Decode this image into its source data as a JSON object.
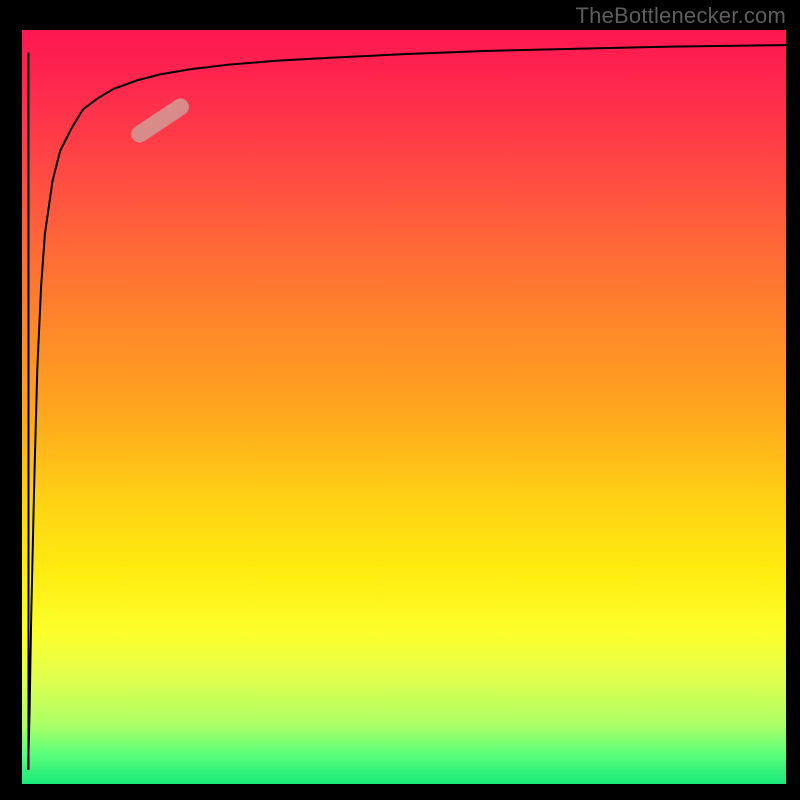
{
  "watermark": "TheBottlenecker.com",
  "chart_data": {
    "type": "line",
    "title": "",
    "xlabel": "",
    "ylabel": "",
    "xlim": [
      0,
      100
    ],
    "ylim": [
      0,
      100
    ],
    "gradient_direction": "vertical",
    "gradient_stops": [
      {
        "pos": 0,
        "color": "#ff1750"
      },
      {
        "pos": 50,
        "color": "#ffb217"
      },
      {
        "pos": 80,
        "color": "#fcff2c"
      },
      {
        "pos": 100,
        "color": "#18e87a"
      }
    ],
    "series": [
      {
        "name": "bottleneck-curve",
        "color": "#000000",
        "x": [
          0.8,
          1.0,
          1.2,
          1.6,
          2.0,
          2.5,
          3.0,
          4.0,
          5.0,
          6.5,
          8.0,
          10,
          12,
          15,
          18,
          22,
          27,
          33,
          40,
          50,
          60,
          72,
          85,
          100
        ],
        "y": [
          2,
          10,
          22,
          40,
          55,
          66,
          73,
          80,
          84,
          87,
          89.5,
          91,
          92.2,
          93.3,
          94.1,
          94.8,
          95.4,
          95.9,
          96.3,
          96.8,
          97.2,
          97.5,
          97.8,
          98
        ]
      }
    ],
    "marker": {
      "name": "highlight-pill",
      "color": "#d98b89",
      "approx_x": 18,
      "approx_y": 88
    }
  }
}
